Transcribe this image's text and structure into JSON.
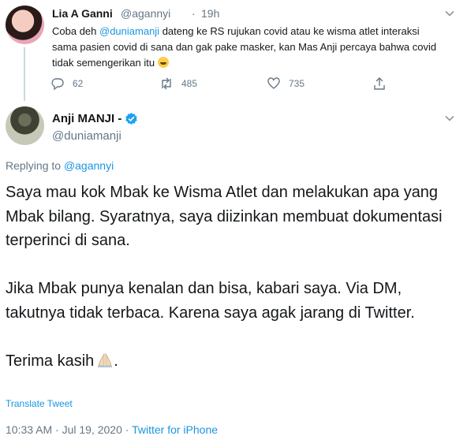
{
  "parent_tweet": {
    "display_name": "Lia A Ganni",
    "handle": "@agannyi",
    "separator": "·",
    "time": "19h",
    "text_before_mention": "Coba deh ",
    "mention": "@duniamanji",
    "text_after_mention": " dateng ke RS rujukan covid atau ke wisma atlet interaksi sama pasien covid di sana dan gak pake masker, kan Mas Anji percaya bahwa covid tidak semengerikan itu",
    "emoji": "grinning-face",
    "actions": {
      "replies": "62",
      "retweets": "485",
      "likes": "735"
    }
  },
  "main_tweet": {
    "display_name": "Anji MANJI -",
    "handle": "@duniamanji",
    "replying_label": "Replying to ",
    "replying_to": "@agannyi",
    "paragraphs": [
      "Saya mau kok Mbak ke Wisma Atlet dan melakukan apa yang Mbak bilang. Syaratnya, saya diizinkan membuat dokumentasi terperinci di sana.",
      "Jika Mbak punya kenalan dan bisa, kabari saya. Via DM, takutnya tidak terbaca. Karena saya agak jarang di Twitter."
    ],
    "closing": "Terima kasih",
    "closing_end": ".",
    "closing_emoji": "folded-hands",
    "translate_label": "Translate Tweet",
    "timestamp": "10:33 AM · Jul 19, 2020 · ",
    "source": "Twitter for iPhone"
  },
  "colors": {
    "link": "#1b95e0",
    "muted": "#657786",
    "text": "#14171a",
    "verified": "#1da1f2"
  }
}
